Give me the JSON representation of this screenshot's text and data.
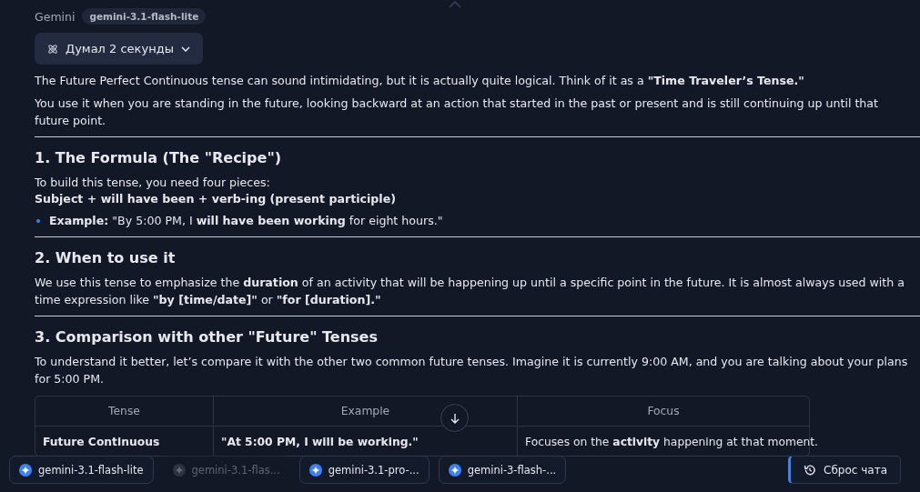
{
  "header": {
    "author": "Gemini",
    "model_badge": "gemini-3.1-flash-lite",
    "thinking": {
      "label": "Думал 2 секунды",
      "expanded": false
    }
  },
  "blocks": [
    {
      "kind": "paragraph",
      "text": "The Future Perfect Continuous tense can sound intimidating, but it is actually quite logical. Think of it as a **\"Time Traveler’s Tense.\"**"
    },
    {
      "kind": "paragraph",
      "text": "You use it when you are standing in the future, looking backward at an action that started in the past or present and is still continuing up until that future point."
    },
    {
      "kind": "rule"
    },
    {
      "kind": "heading",
      "text": "1. The Formula (The \"Recipe\")"
    },
    {
      "kind": "lines",
      "lines": [
        "To build this tense, you need four pieces:",
        "**Subject + will have been + verb-ing (present participle)**"
      ]
    },
    {
      "kind": "bullet",
      "text": "**Example:** \"By 5:00 PM, I **will have been working** for eight hours.\""
    },
    {
      "kind": "rule"
    },
    {
      "kind": "heading",
      "text": "2. When to use it"
    },
    {
      "kind": "paragraph",
      "text": "We use this tense to emphasize the **duration** of an activity that will be happening up until a specific point in the future. It is almost always used with a time expression like **\"by [time/date]\"** or **\"for [duration].\"**"
    },
    {
      "kind": "rule"
    },
    {
      "kind": "heading",
      "text": "3. Comparison with other \"Future\" Tenses"
    },
    {
      "kind": "paragraph",
      "text": "To understand it better, let’s compare it with the other two common future tenses. Imagine it is currently 9:00 AM, and you are talking about your plans for 5:00 PM."
    }
  ],
  "table": {
    "columns": [
      "Tense",
      "Example",
      "Focus"
    ],
    "rows": [
      [
        "**Future Continuous**",
        "**\"At 5:00 PM, I will be working.\"**",
        "Focuses on the **activity** happening at that moment."
      ]
    ]
  },
  "model_chips": [
    {
      "label": "gemini-3.1-flash-lite",
      "disabled": false
    },
    {
      "label": "gemini-3.1-flas...",
      "disabled": true
    },
    {
      "label": "gemini-3.1-pro-...",
      "disabled": false
    },
    {
      "label": "gemini-3-flash-...",
      "disabled": false
    }
  ],
  "reset_button": {
    "label": "Сброс чата"
  }
}
